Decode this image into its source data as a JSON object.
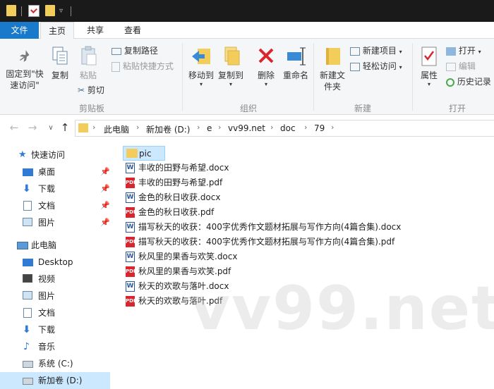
{
  "tabs": {
    "file": "文件",
    "home": "主页",
    "share": "共享",
    "view": "查看"
  },
  "ribbon": {
    "pin_quick_access": "固定到\"快速访问\"",
    "copy": "复制",
    "paste": "粘贴",
    "copy_path": "复制路径",
    "paste_shortcut": "粘贴快捷方式",
    "cut": "剪切",
    "clipboard_group": "剪贴板",
    "move_to": "移动到",
    "copy_to": "复制到",
    "delete": "删除",
    "rename": "重命名",
    "organize_group": "组织",
    "new_folder": "新建文件夹",
    "new_item": "新建项目",
    "easy_access": "轻松访问",
    "new_group": "新建",
    "properties": "属性",
    "open": "打开",
    "edit": "编辑",
    "history": "历史记录",
    "open_group": "打开"
  },
  "breadcrumb": [
    "此电脑",
    "新加卷 (D:)",
    "e",
    "vv99.net",
    "doc",
    "79"
  ],
  "nav": {
    "quick_access": "快速访问",
    "quick_items": [
      "桌面",
      "下载",
      "文档",
      "图片"
    ],
    "this_pc": "此电脑",
    "pc_items": [
      "Desktop",
      "视频",
      "图片",
      "文档",
      "下载",
      "音乐",
      "系统 (C:)",
      "新加卷 (D:)"
    ]
  },
  "files": [
    {
      "name": "pic",
      "type": "folder"
    },
    {
      "name": "丰收的田野与希望.docx",
      "type": "docx"
    },
    {
      "name": "丰收的田野与希望.pdf",
      "type": "pdf"
    },
    {
      "name": "金色的秋日收获.docx",
      "type": "docx"
    },
    {
      "name": "金色的秋日收获.pdf",
      "type": "pdf"
    },
    {
      "name": "描写秋天的收获：400字优秀作文题材拓展与写作方向(4篇合集).docx",
      "type": "docx"
    },
    {
      "name": "描写秋天的收获：400字优秀作文题材拓展与写作方向(4篇合集).pdf",
      "type": "pdf"
    },
    {
      "name": "秋风里的果香与欢笑.docx",
      "type": "docx"
    },
    {
      "name": "秋风里的果香与欢笑.pdf",
      "type": "pdf"
    },
    {
      "name": "秋天的欢歌与落叶.docx",
      "type": "docx"
    },
    {
      "name": "秋天的欢歌与落叶.pdf",
      "type": "pdf"
    }
  ],
  "watermark": "vv99.net"
}
